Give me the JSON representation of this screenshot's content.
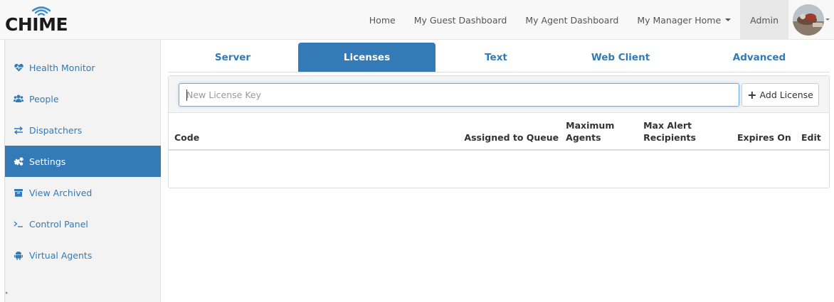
{
  "brand": {
    "logo_text": "CHIME"
  },
  "topnav": {
    "links": [
      {
        "label": "Home"
      },
      {
        "label": "My Guest Dashboard"
      },
      {
        "label": "My Agent Dashboard"
      },
      {
        "label": "My Manager Home"
      },
      {
        "label": "Admin"
      }
    ]
  },
  "sidebar": {
    "items": [
      {
        "label": "Health Monitor",
        "icon": "heartbeat-icon"
      },
      {
        "label": "People",
        "icon": "users-icon"
      },
      {
        "label": "Dispatchers",
        "icon": "exchange-icon"
      },
      {
        "label": "Settings",
        "icon": "cogs-icon",
        "active": true
      },
      {
        "label": "View Archived",
        "icon": "archive-icon"
      },
      {
        "label": "Control Panel",
        "icon": "terminal-icon"
      },
      {
        "label": "Virtual Agents",
        "icon": "android-icon"
      }
    ]
  },
  "tabs": [
    {
      "label": "Server"
    },
    {
      "label": "Licenses",
      "active": true
    },
    {
      "label": "Text"
    },
    {
      "label": "Web Client"
    },
    {
      "label": "Advanced"
    }
  ],
  "licenses": {
    "input_placeholder": "New License Key",
    "input_value": "",
    "add_button_label": "Add License",
    "columns": {
      "code": "Code",
      "queue": "Assigned to Queue",
      "max_agents_line1": "Maximum",
      "max_agents_line2": "Agents",
      "max_alert_line1": "Max Alert",
      "max_alert_line2": "Recipients",
      "expires": "Expires On",
      "edit": "Edit"
    },
    "rows": []
  },
  "colors": {
    "accent": "#337ab7",
    "navbar_bg": "#f8f8f8",
    "sidebar_bg": "#f3f3f3"
  }
}
